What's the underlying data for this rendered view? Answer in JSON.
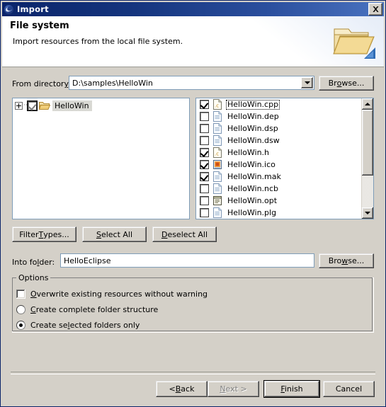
{
  "window": {
    "title": "Import",
    "icon": "eclipse-globe-icon",
    "close_label": "✕"
  },
  "header": {
    "title": "File system",
    "description": "Import resources from the local file system.",
    "icon": "open-folder-icon"
  },
  "from_directory": {
    "label": "From director",
    "label_mnemonic": "y",
    "label_suffix": ":",
    "value": "D:\\samples\\HelloWin",
    "browse_label_pre": "Br",
    "browse_label_mnemonic": "o",
    "browse_label_post": "wse..."
  },
  "tree": {
    "items": [
      {
        "label": "HelloWin",
        "checkbox_state": "grayed",
        "expanded": false,
        "selected": true,
        "icon": "folder-open-icon"
      }
    ]
  },
  "files": {
    "items": [
      {
        "name": "HelloWin.cpp",
        "checked": true,
        "icon": "c-source-icon",
        "focused": true
      },
      {
        "name": "HelloWin.dep",
        "checked": false,
        "icon": "document-icon",
        "focused": false
      },
      {
        "name": "HelloWin.dsp",
        "checked": false,
        "icon": "document-icon",
        "focused": false
      },
      {
        "name": "HelloWin.dsw",
        "checked": false,
        "icon": "document-icon",
        "focused": false
      },
      {
        "name": "HelloWin.h",
        "checked": true,
        "icon": "c-source-icon",
        "focused": false
      },
      {
        "name": "HelloWin.ico",
        "checked": true,
        "icon": "image-icon",
        "focused": false
      },
      {
        "name": "HelloWin.mak",
        "checked": true,
        "icon": "document-icon",
        "focused": false
      },
      {
        "name": "HelloWin.ncb",
        "checked": false,
        "icon": "document-icon",
        "focused": false
      },
      {
        "name": "HelloWin.opt",
        "checked": false,
        "icon": "notepad-icon",
        "focused": false
      },
      {
        "name": "HelloWin.plg",
        "checked": false,
        "icon": "document-icon",
        "focused": false
      }
    ],
    "scrollbar": {
      "up_arrow": "scroll-up-icon",
      "down_arrow": "scroll-down-icon"
    }
  },
  "list_buttons": {
    "filter_types_pre": "Filter ",
    "filter_types_mnemonic": "T",
    "filter_types_post": "ypes...",
    "select_all_mnemonic": "S",
    "select_all_post": "elect All",
    "deselect_all_mnemonic": "D",
    "deselect_all_post": "eselect All"
  },
  "into_folder": {
    "label": "Into fo",
    "label_mnemonic": "l",
    "label_post": "der:",
    "value": "HelloEclipse",
    "browse_label_pre": "Bro",
    "browse_label_mnemonic": "w",
    "browse_label_post": "se..."
  },
  "options": {
    "group_title": "Options",
    "overwrite": {
      "checked": false,
      "mnemonic": "O",
      "label_post": "verwrite existing resources without warning"
    },
    "create_complete": {
      "selected": false,
      "mnemonic": "C",
      "label_post": "reate complete folder structure"
    },
    "create_selected": {
      "selected": true,
      "label_pre": "Create se",
      "mnemonic": "l",
      "label_post": "ected folders only"
    }
  },
  "wizard_buttons": {
    "back_pre": "< ",
    "back_mnemonic": "B",
    "back_post": "ack",
    "next_mnemonic": "N",
    "next_post": "ext >",
    "next_enabled": false,
    "finish_mnemonic": "F",
    "finish_post": "inish",
    "finish_default": true,
    "cancel_label": "Cancel"
  },
  "colors": {
    "dialog_face": "#d4d0c8",
    "title_start": "#0a246a",
    "title_end": "#4a73c0",
    "field_border": "#7f9db9",
    "folder_gold": "#e8c86a",
    "accent_blue": "#2b5fa8"
  }
}
